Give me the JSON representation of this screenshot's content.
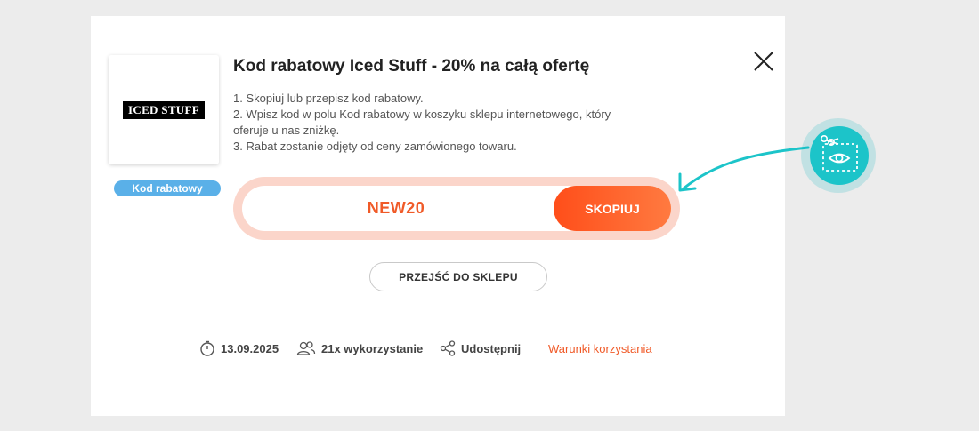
{
  "modal": {
    "title": "Kod rabatowy Iced Stuff - 20% na całą ofertę",
    "instructions": [
      "1. Skopiuj lub przepisz kod rabatowy.",
      "2. Wpisz kod w polu Kod rabatowy w koszyku sklepu internetowego, który",
      "oferuje u nas zniżkę.",
      "3. Rabat zostanie odjęty od ceny zamówionego towaru."
    ],
    "brand_logo_text": "ICED STUFF",
    "type_badge": "Kod rabatowy",
    "code": "NEW20",
    "copy_label": "SKOPIUJ",
    "shop_label": "PRZEJŚĆ DO SKLEPU",
    "meta": {
      "date": "13.09.2025",
      "usage": "21x wykorzystanie",
      "share": "Udostępnij",
      "terms": "Warunki korzystania"
    }
  },
  "icons": {
    "close": "close-icon",
    "clock": "clock-icon",
    "users": "users-icon",
    "share": "share-icon",
    "callout": "scissors-coupon-icon"
  },
  "colors": {
    "accent": "#f05a28",
    "badge": "#5ab0e8",
    "callout": "#1cc4c9"
  }
}
